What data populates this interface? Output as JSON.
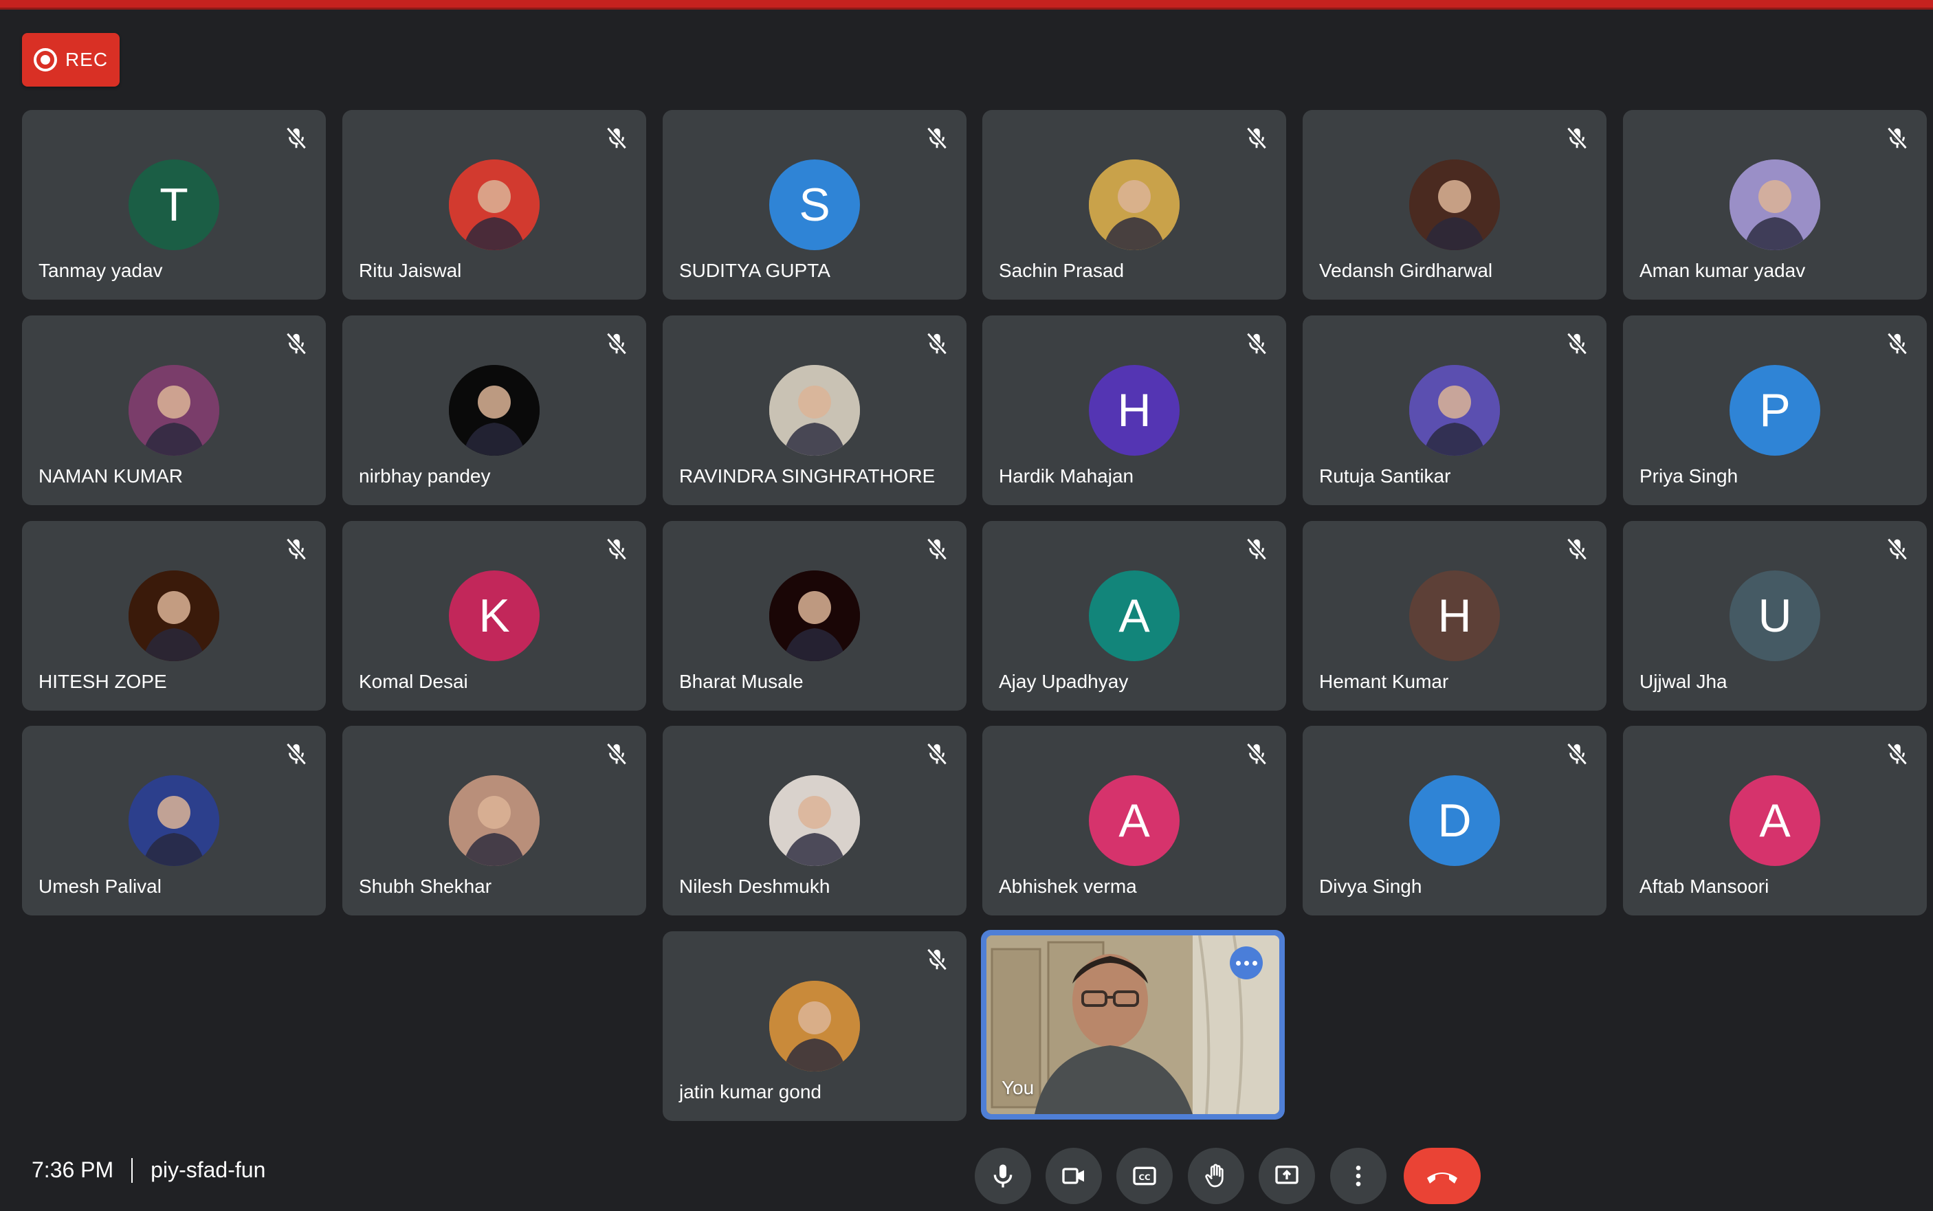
{
  "recording": {
    "label": "REC"
  },
  "participants": [
    {
      "name": "Tanmay yadav",
      "initial": "T",
      "avatar_color": "#1b5e45"
    },
    {
      "name": "Ritu Jaiswal",
      "photo": true,
      "avatar_color": "#d23a2f"
    },
    {
      "name": "SUDITYA GUPTA",
      "initial": "S",
      "avatar_color": "#2f84d6"
    },
    {
      "name": "Sachin Prasad",
      "photo": true,
      "avatar_color": "#c9a24a"
    },
    {
      "name": "Vedansh Girdharwal",
      "photo": true,
      "avatar_color": "#4a2a20"
    },
    {
      "name": "Aman kumar yadav",
      "photo": true,
      "avatar_color": "#9a8fc7"
    },
    {
      "name": "NAMAN KUMAR",
      "photo": true,
      "avatar_color": "#7a3d6a"
    },
    {
      "name": "nirbhay pandey",
      "photo": true,
      "avatar_color": "#0a0a0a"
    },
    {
      "name": "RAVINDRA SINGHRATHORE",
      "photo": true,
      "avatar_color": "#c9c2b4"
    },
    {
      "name": "Hardik Mahajan",
      "initial": "H",
      "avatar_color": "#5435b3"
    },
    {
      "name": "Rutuja Santikar",
      "photo": true,
      "avatar_color": "#5b4fb0"
    },
    {
      "name": "Priya Singh",
      "initial": "P",
      "avatar_color": "#2f84d6"
    },
    {
      "name": "HITESH ZOPE",
      "photo": true,
      "avatar_color": "#3a1a0a"
    },
    {
      "name": "Komal Desai",
      "initial": "K",
      "avatar_color": "#c2275a"
    },
    {
      "name": "Bharat Musale",
      "photo": true,
      "avatar_color": "#1a0606"
    },
    {
      "name": "Ajay Upadhyay",
      "initial": "A",
      "avatar_color": "#12857a"
    },
    {
      "name": "Hemant Kumar",
      "initial": "H",
      "avatar_color": "#5d4037"
    },
    {
      "name": "Ujjwal Jha",
      "initial": "U",
      "avatar_color": "#455a64"
    },
    {
      "name": "Umesh Palival",
      "photo": true,
      "avatar_color": "#2c3f8c"
    },
    {
      "name": "Shubh Shekhar",
      "photo": true,
      "avatar_color": "#b98f7a"
    },
    {
      "name": "Nilesh Deshmukh",
      "photo": true,
      "avatar_color": "#d9d2cc"
    },
    {
      "name": "Abhishek verma",
      "initial": "A",
      "avatar_color": "#d6336c"
    },
    {
      "name": "Divya Singh",
      "initial": "D",
      "avatar_color": "#2f84d6"
    },
    {
      "name": "Aftab Mansoori",
      "initial": "A",
      "avatar_color": "#d6336c"
    },
    {
      "name": "jatin kumar gond",
      "photo": true,
      "avatar_color": "#c98a3a"
    }
  ],
  "self_view": {
    "name": "You"
  },
  "meeting": {
    "time": "7:36 PM",
    "code": "piy-sfad-fun"
  },
  "controls": [
    "microphone-icon",
    "camera-icon",
    "captions-icon",
    "raise-hand-icon",
    "present-icon",
    "more-options-icon",
    "end-call-icon"
  ],
  "colors": {
    "background": "#202124",
    "tile": "#3c4043",
    "end_call": "#ea4335",
    "rec": "#d93025",
    "self_border": "#4f7fd6"
  }
}
